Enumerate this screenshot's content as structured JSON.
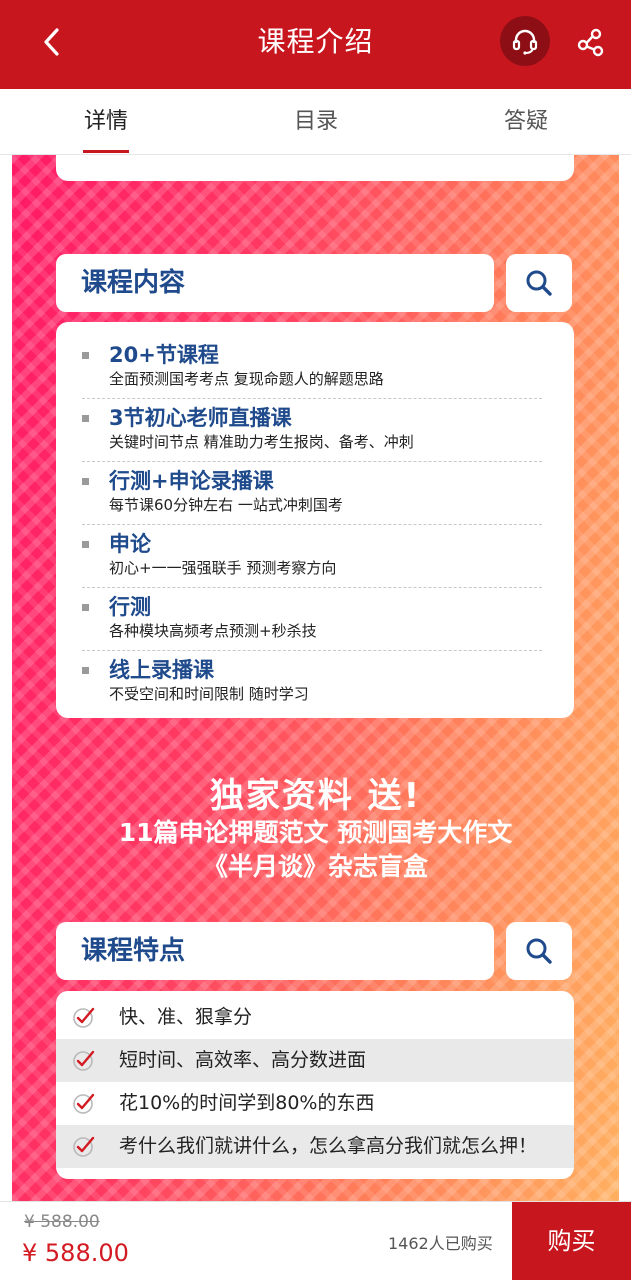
{
  "header": {
    "title": "课程介绍",
    "back_icon": "chevron-left-icon",
    "service_icon": "headset-icon",
    "share_icon": "share-icon",
    "brand_color": "#c8161f"
  },
  "tabs": [
    {
      "label": "详情",
      "active": true
    },
    {
      "label": "目录",
      "active": false
    },
    {
      "label": "答疑",
      "active": false
    }
  ],
  "course_content": {
    "heading": "课程内容",
    "items": [
      {
        "title": "20+节课程",
        "desc": "全面预测国考考点 复现命题人的解题思路"
      },
      {
        "title": "3节初心老师直播课",
        "desc": "关键时间节点 精准助力考生报岗、备考、冲刺"
      },
      {
        "title": "行测+申论录播课",
        "desc": "每节课60分钟左右 一站式冲刺国考"
      },
      {
        "title": "申论",
        "desc": "初心+一一强强联手 预测考察方向"
      },
      {
        "title": "行测",
        "desc": "各种模块高频考点预测+秒杀技"
      },
      {
        "title": "线上录播课",
        "desc": "不受空间和时间限制 随时学习"
      }
    ]
  },
  "promo": {
    "line1": "独家资料 送!",
    "line2": "11篇申论押题范文 预测国考大作文",
    "line3": "《半月谈》杂志盲盒"
  },
  "course_features": {
    "heading": "课程特点",
    "items": [
      "快、准、狠拿分",
      "短时间、高效率、高分数进面",
      "花10%的时间学到80%的东西",
      "考什么我们就讲什么，怎么拿高分我们就怎么押！"
    ]
  },
  "purchase": {
    "old_price": "¥ 588.00",
    "price": "¥ 588.00",
    "sold_count": "1462人已购买",
    "buy_label": "购买"
  }
}
